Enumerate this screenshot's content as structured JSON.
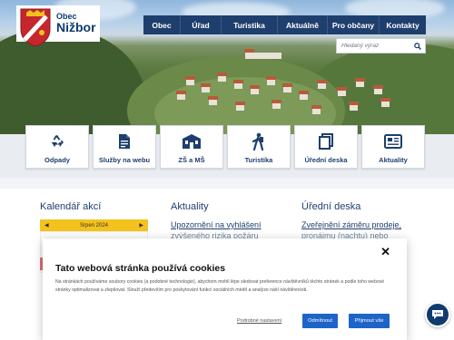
{
  "brand": {
    "small": "Obec",
    "big": "Nižbor"
  },
  "nav": [
    {
      "label": "Obec",
      "w": 41
    },
    {
      "label": "Úřad",
      "w": 45
    },
    {
      "label": "Turistika",
      "w": 62
    },
    {
      "label": "Aktuálně",
      "w": 55
    },
    {
      "label": "Pro občany",
      "w": 57
    },
    {
      "label": "Kontakty",
      "w": 51
    }
  ],
  "search": {
    "placeholder": "Hledaný výraz"
  },
  "tiles": [
    {
      "label": "Odpady",
      "icon": "recycle-icon"
    },
    {
      "label": "Služby na webu",
      "icon": "document-icon"
    },
    {
      "label": "ZŠ a MŠ",
      "icon": "school-icon"
    },
    {
      "label": "Turistika",
      "icon": "hiker-icon"
    },
    {
      "label": "Úřední deska",
      "icon": "copy-icon"
    },
    {
      "label": "Aktuality",
      "icon": "newspaper-icon"
    }
  ],
  "sections": {
    "calendar": {
      "title": "Kalendář akcí",
      "month": "Srpen 2024"
    },
    "news": {
      "title": "Aktuality",
      "first_link": "Upozornění na vyhlášení",
      "second_link": "zvýšeného rizika požáru"
    },
    "board": {
      "title": "Úřední deska",
      "first_link": "Zveřejnění záměru prodeje,",
      "second_link": "pronájmu (nachtu) nebo"
    }
  },
  "cookie": {
    "title": "Tato webová stránka používá cookies",
    "text": "Na stránkách používáme soubory cookies (a podobné technologie), abychom mohli lépe sledovat preference návštěvníků těchto stránek a podle toho webové stránky optimalizovat a zlepšovat. Slouží především pro poskytování funkcí sociálních médií a analýze náší návštěvnosti.",
    "settings_link": "Podrobné nastavení",
    "reject_label": "Odmítnout",
    "accept_label": "Přijmout vše"
  },
  "colors": {
    "navy": "#1e3f6d",
    "yellow": "#f4c21c",
    "blue": "#1e64c8",
    "red": "#c6262e"
  }
}
